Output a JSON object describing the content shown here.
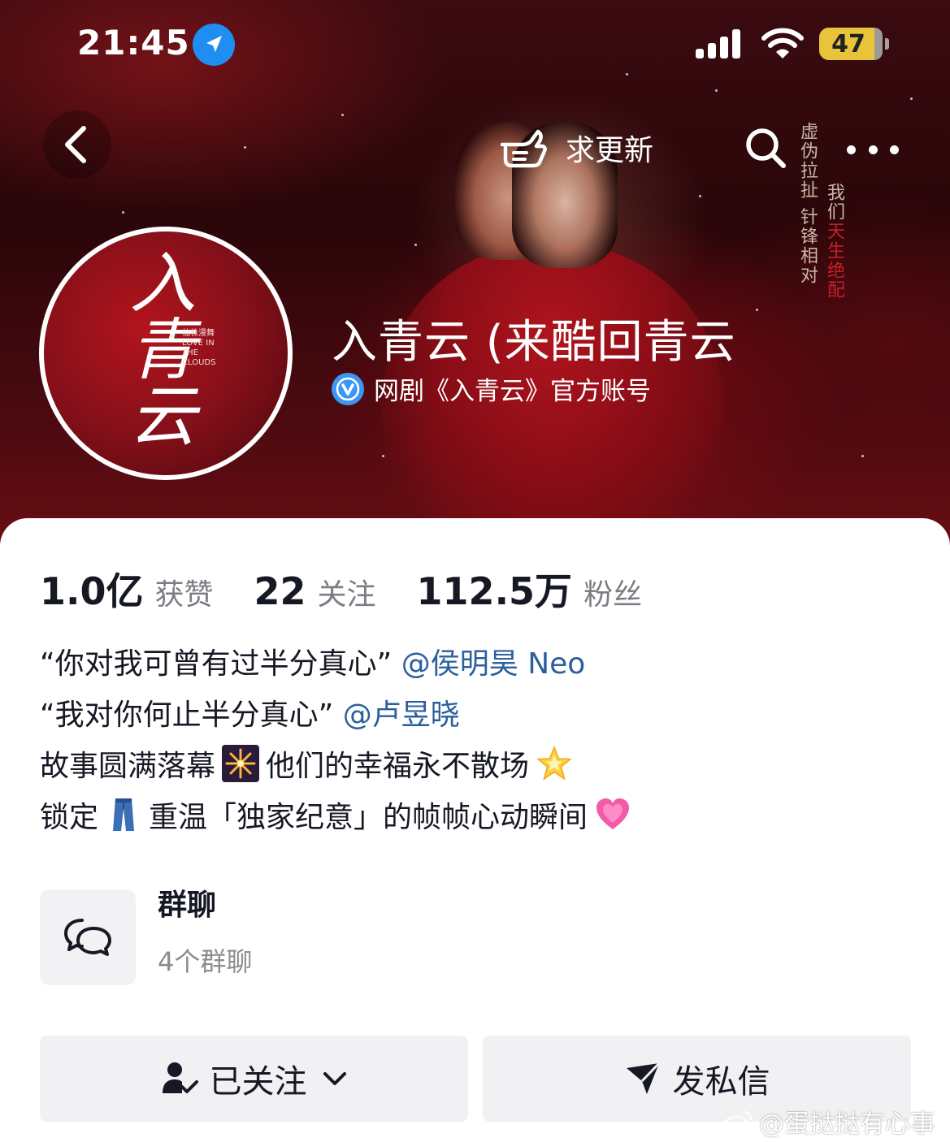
{
  "status_bar": {
    "time": "21:45",
    "battery": "47",
    "accent_location": "#1f8ef1",
    "battery_color": "#e7c43a"
  },
  "nav": {
    "update_label": "求更新"
  },
  "banner": {
    "poster_text_1": "虚伪拉扯 针锋相对",
    "poster_text_2a": "我们",
    "poster_text_2b": "天生绝配"
  },
  "avatar": {
    "title": "入青云",
    "subtitle_cn": "仙株漫舞",
    "subtitle_en": "LOVE IN THE CLOUDS"
  },
  "profile": {
    "name": "入青云 (来酷回青云",
    "verification": "网剧《入青云》官方账号"
  },
  "stats": [
    {
      "value": "1.0亿",
      "label": "获赞"
    },
    {
      "value": "22",
      "label": "关注"
    },
    {
      "value": "112.5万",
      "label": "粉丝"
    }
  ],
  "bio": {
    "line1_text": "“你对我可曾有过半分真心”",
    "line1_mention": "@侯明昊 Neo",
    "line2_text": "“我对你何止半分真心”",
    "line2_mention": "@卢昱晓",
    "line3_a": "故事圆满落幕",
    "line3_b": "他们的幸福永不散场",
    "line4_a": "锁定",
    "line4_b": "重温「独家纪意」的帧帧心动瞬间",
    "mention_color": "#2b5f9e"
  },
  "group": {
    "title": "群聊",
    "count": "4个群聊"
  },
  "actions": {
    "follow": "已关注",
    "message": "发私信"
  },
  "watermark": "@蛋挞挞有心事"
}
